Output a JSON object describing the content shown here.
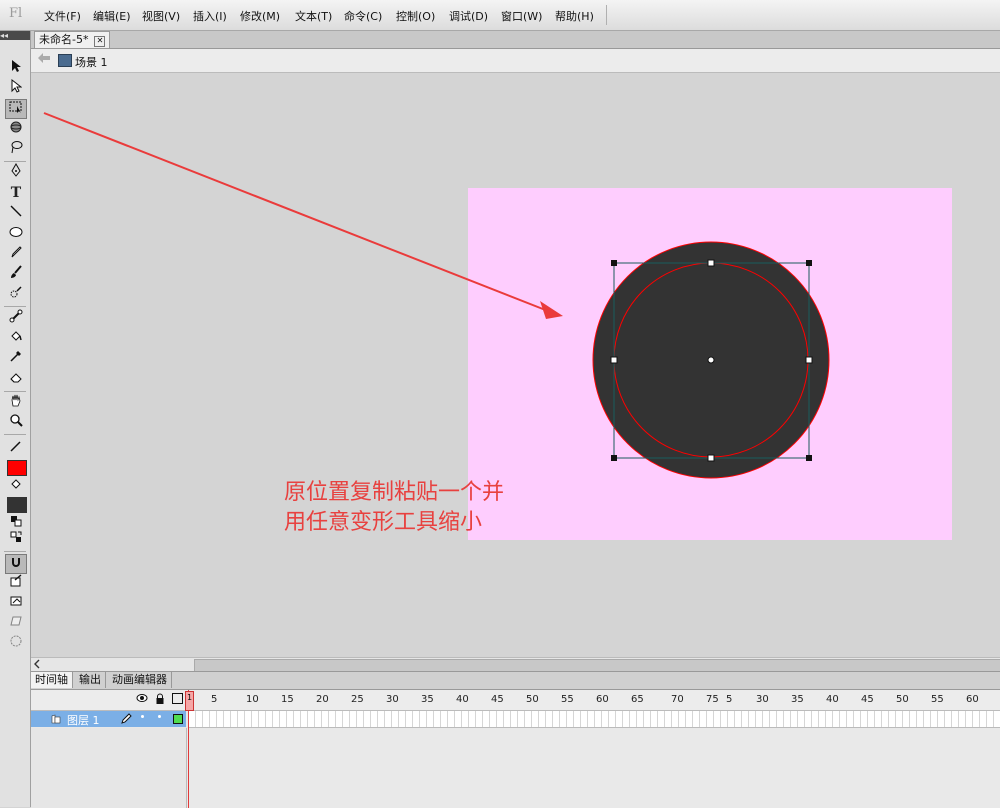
{
  "app": {
    "logo_text": "Fl"
  },
  "menu": {
    "items": [
      {
        "label": "文件(F)"
      },
      {
        "label": "编辑(E)"
      },
      {
        "label": "视图(V)"
      },
      {
        "label": "插入(I)"
      },
      {
        "label": "修改(M)"
      },
      {
        "label": "文本(T)"
      },
      {
        "label": "命令(C)"
      },
      {
        "label": "控制(O)"
      },
      {
        "label": "调试(D)"
      },
      {
        "label": "窗口(W)"
      },
      {
        "label": "帮助(H)"
      }
    ]
  },
  "toolbar": {
    "collapse_label": "◂◂",
    "stroke_color": "#ff0000",
    "fill_color": "#333333"
  },
  "document": {
    "tab_label": "未命名-5*",
    "tab_close": "✕",
    "scene_label": "场景 1"
  },
  "stage": {
    "background": "#fecdfe",
    "circle_fill": "#333333",
    "circle_stroke": "#ff0000"
  },
  "annotation": {
    "line1": "原位置复制粘贴一个并",
    "line2": "用任意变形工具缩小",
    "color": "#e8413f"
  },
  "timeline": {
    "tabs": [
      "时间轴",
      "输出",
      "动画编辑器"
    ],
    "frame_numbers": [
      "1",
      "5",
      "10",
      "15",
      "20",
      "25",
      "30",
      "35",
      "40",
      "45",
      "50",
      "55",
      "60",
      "65",
      "70",
      "75",
      "5",
      "30",
      "35",
      "40",
      "45",
      "50",
      "55",
      "60"
    ],
    "layer_name": "图层 1"
  }
}
